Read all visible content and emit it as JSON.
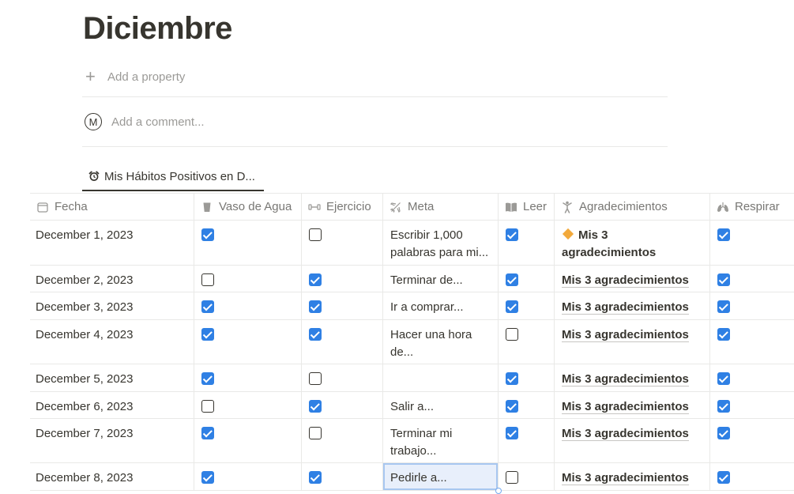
{
  "page": {
    "title": "Diciembre"
  },
  "properties": {
    "add_label": "Add a property"
  },
  "comment": {
    "avatar_letter": "M",
    "placeholder": "Add a comment..."
  },
  "view_tab": {
    "label": "Mis Hábitos Positivos en D...",
    "icon": "alarm-clock-icon"
  },
  "columns": [
    {
      "label": "Fecha",
      "icon": "calendar-icon"
    },
    {
      "label": "Vaso de Agua",
      "icon": "glass-icon"
    },
    {
      "label": "Ejercicio",
      "icon": "dumbbell-icon"
    },
    {
      "label": "Meta",
      "icon": "plane-icon"
    },
    {
      "label": "Leer",
      "icon": "book-icon"
    },
    {
      "label": "Agradecimientos",
      "icon": "person-icon"
    },
    {
      "label": "Respirar",
      "icon": "lungs-icon"
    }
  ],
  "rows": [
    {
      "fecha": "December 1, 2023",
      "agua": true,
      "ejercicio": false,
      "meta": "Escribir 1,000 palabras para mi...",
      "leer": true,
      "agradecimientos": "Mis 3 agradecimientos",
      "respirar": true
    },
    {
      "fecha": "December 2, 2023",
      "agua": false,
      "ejercicio": true,
      "meta": "Terminar de...",
      "leer": true,
      "agradecimientos": "Mis 3 agradecimientos",
      "respirar": true
    },
    {
      "fecha": "December 3, 2023",
      "agua": true,
      "ejercicio": true,
      "meta": "Ir a comprar...",
      "leer": true,
      "agradecimientos": "Mis 3 agradecimientos",
      "respirar": true
    },
    {
      "fecha": "December 4, 2023",
      "agua": true,
      "ejercicio": true,
      "meta": "Hacer una hora de...",
      "leer": false,
      "agradecimientos": "Mis 3 agradecimientos",
      "respirar": true
    },
    {
      "fecha": "December 5, 2023",
      "agua": true,
      "ejercicio": false,
      "meta": "",
      "leer": true,
      "agradecimientos": "Mis 3 agradecimientos",
      "respirar": true
    },
    {
      "fecha": "December 6, 2023",
      "agua": false,
      "ejercicio": true,
      "meta": "Salir a...",
      "leer": true,
      "agradecimientos": "Mis 3 agradecimientos",
      "respirar": true
    },
    {
      "fecha": "December 7, 2023",
      "agua": true,
      "ejercicio": false,
      "meta": "Terminar mi trabajo...",
      "leer": true,
      "agradecimientos": "Mis 3 agradecimientos",
      "respirar": true
    },
    {
      "fecha": "December 8, 2023",
      "agua": true,
      "ejercicio": true,
      "meta": "Pedirle a...",
      "leer": false,
      "agradecimientos": "Mis 3 agradecimientos",
      "respirar": true
    }
  ],
  "colors": {
    "checkbox_checked": "#2f80e4",
    "text": "#37352f",
    "muted": "#9b9a97"
  }
}
